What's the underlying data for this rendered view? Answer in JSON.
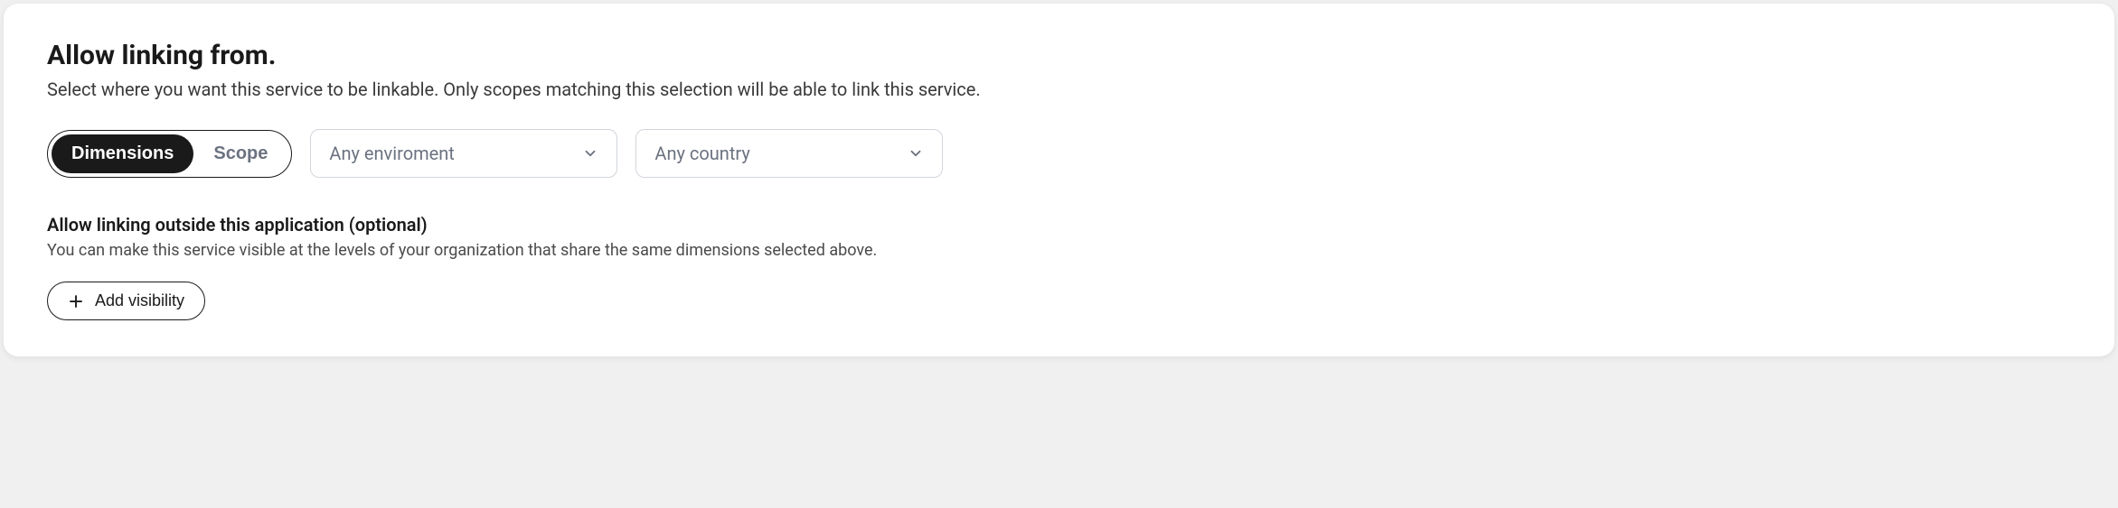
{
  "header": {
    "title": "Allow linking from.",
    "subtitle": "Select where you want this service to be linkable. Only scopes matching this selection will be able to link this service."
  },
  "segmented": {
    "option1": "Dimensions",
    "option2": "Scope"
  },
  "selects": {
    "environment": "Any enviroment",
    "country": "Any country"
  },
  "outside": {
    "heading": "Allow linking outside this application (optional)",
    "description": "You can make this service visible at the levels of your organization that share the same dimensions selected above."
  },
  "buttons": {
    "add_visibility": "Add visibility"
  }
}
